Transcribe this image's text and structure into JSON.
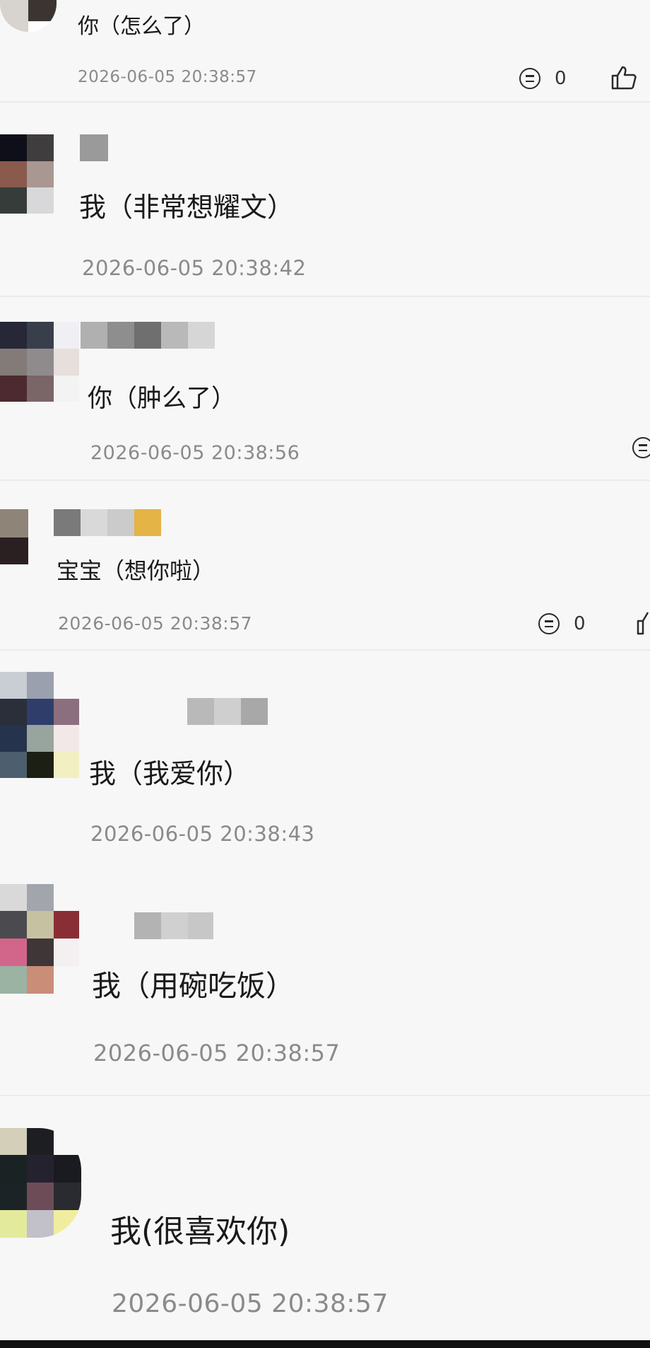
{
  "comments": [
    {
      "text": "你（怎么了）",
      "time": "2026-06-05 20:38:57",
      "reply_count": "0"
    },
    {
      "text": "我（非常想耀文）",
      "time": "2026-06-05 20:38:42"
    },
    {
      "text": "你（肿么了）",
      "time": "2026-06-05 20:38:56"
    },
    {
      "text": "宝宝（想你啦）",
      "time": "2026-06-05 20:38:57",
      "reply_count": "0"
    },
    {
      "text": "我（我爱你）",
      "time": "2026-06-05 20:38:43"
    },
    {
      "text": "我（用碗吃饭）",
      "time": "2026-06-05 20:38:57"
    },
    {
      "text": "我(很喜欢你)",
      "time": "2026-06-05 20:38:57"
    }
  ],
  "icons": {
    "reply": "comment-reply-icon",
    "like": "thumbs-up-icon"
  },
  "colors": {
    "background": "#f7f7f7",
    "text": "#1a1a1a",
    "timestamp": "#8a8a8a",
    "separator": "#ebebeb"
  }
}
